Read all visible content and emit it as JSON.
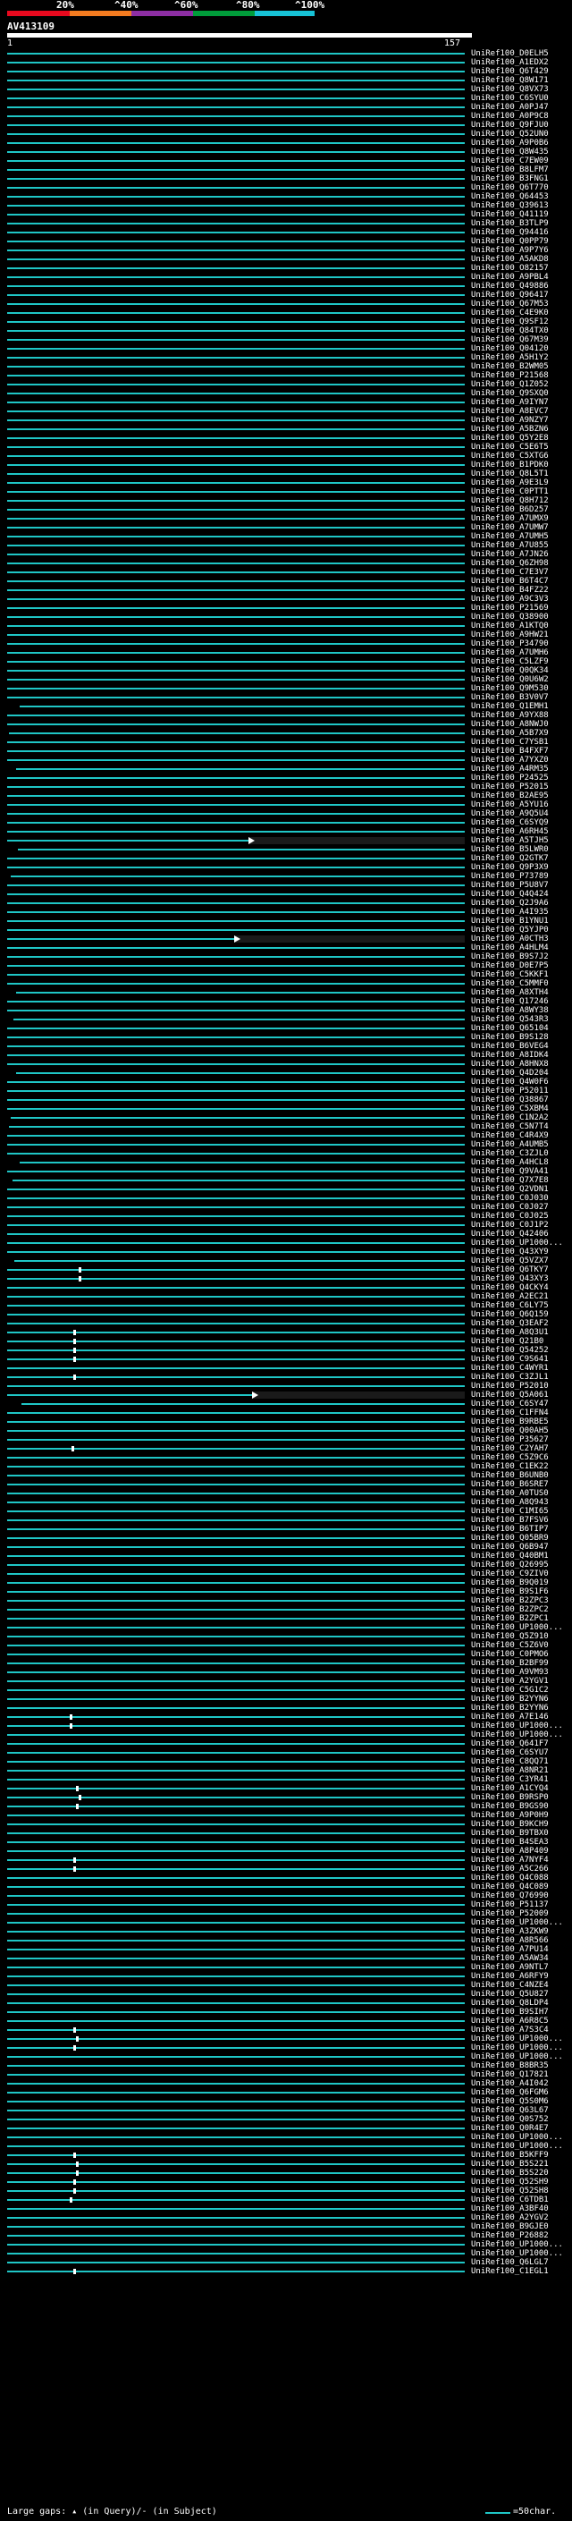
{
  "scale": {
    "labels": [
      "20%",
      "^40%",
      "^60%",
      "^80%",
      "^100%"
    ],
    "colors": [
      "#e8091e",
      "#f47b20",
      "#8d2ea3",
      "#009c3a",
      "#17c2d6"
    ]
  },
  "query": {
    "title": "AV413109",
    "start": "1",
    "end": "157"
  },
  "legend": {
    "gaps": "Large gaps: ▴ (in Query)/- (in Subject)",
    "scale": "=50char."
  },
  "hit_color": "#1fc6c6",
  "hits": [
    "UniRef100_D0ELH5",
    "UniRef100_A1EDX2",
    "UniRef100_Q6T429",
    "UniRef100_Q8W171",
    "UniRef100_Q8VX73",
    "UniRef100_C6SYU0",
    "UniRef100_A0PJ47",
    "UniRef100_A0P9C8",
    "UniRef100_Q9FJU0",
    "UniRef100_Q52UN0",
    "UniRef100_A9P0B6",
    "UniRef100_Q8W435",
    "UniRef100_C7EW09",
    "UniRef100_B8LFM7",
    "UniRef100_B3FNG1",
    "UniRef100_Q6T770",
    "UniRef100_Q64453",
    "UniRef100_Q39613",
    "UniRef100_Q41119",
    "UniRef100_B3TLP9",
    "UniRef100_Q94416",
    "UniRef100_Q0PP79",
    "UniRef100_A9P7Y6",
    "UniRef100_A5AKD8",
    "UniRef100_O82157",
    "UniRef100_A9PBL4",
    "UniRef100_Q49886",
    "UniRef100_Q96417",
    "UniRef100_Q67M53",
    "UniRef100_C4E9K0",
    "UniRef100_Q9SF12",
    "UniRef100_Q84TX0",
    "UniRef100_Q67M39",
    "UniRef100_Q04120",
    "UniRef100_A5H1Y2",
    "UniRef100_B2WM05",
    "UniRef100_P21568",
    "UniRef100_Q1Z052",
    "UniRef100_Q9SXQ0",
    "UniRef100_A9IYN7",
    "UniRef100_A8EVC7",
    "UniRef100_A9NZY7",
    "UniRef100_A5BZN6",
    "UniRef100_Q5Y2E8",
    "UniRef100_C5E6T5",
    "UniRef100_C5XTG6",
    "UniRef100_B1PDK0",
    "UniRef100_Q8L5T1",
    "UniRef100_A9E3L9",
    "UniRef100_C0PTT1",
    "UniRef100_Q8H712",
    "UniRef100_B6D257",
    "UniRef100_A7UMX9",
    "UniRef100_A7UMW7",
    "UniRef100_A7UMH5",
    "UniRef100_A7U855",
    "UniRef100_A7JN26",
    "UniRef100_Q6ZH98",
    "UniRef100_C7E3V7",
    "UniRef100_B6T4C7",
    "UniRef100_B4FZ22",
    "UniRef100_A9C3V3",
    "UniRef100_P21569",
    "UniRef100_Q38900",
    "UniRef100_A1KTQ0",
    "UniRef100_A9HW21",
    "UniRef100_P34790",
    "UniRef100_A7UMH6",
    "UniRef100_C5LZF9",
    "UniRef100_Q0QK34",
    "UniRef100_Q0U6W2",
    "UniRef100_Q9M530",
    "UniRef100_B3V0V7",
    "UniRef100_Q1EMH1",
    "UniRef100_A9YX88",
    "UniRef100_A8NWJ0",
    "UniRef100_A5B7X9",
    "UniRef100_C7YSB1",
    "UniRef100_B4FXF7",
    "UniRef100_A7YXZ0",
    "UniRef100_A4RM35",
    "UniRef100_P24525",
    "UniRef100_P52015",
    "UniRef100_B2AE95",
    "UniRef100_A5YU16",
    "UniRef100_A9Q5U4",
    "UniRef100_C6SYQ9",
    "UniRef100_A6RH45",
    "UniRef100_A5TJH5",
    "UniRef100_B5LWR0",
    "UniRef100_Q2GTK7",
    "UniRef100_Q9P3X9",
    "UniRef100_P73789",
    "UniRef100_P5U8V7",
    "UniRef100_Q4Q424",
    "UniRef100_Q2J9A6",
    "UniRef100_A4I935",
    "UniRef100_B1YNU1",
    "UniRef100_Q5YJP0",
    "UniRef100_A0CTH3",
    "UniRef100_A4HLM4",
    "UniRef100_B9S7J2",
    "UniRef100_D0E7P5",
    "UniRef100_C5KKF1",
    "UniRef100_C5MMF0",
    "UniRef100_A8XTH4",
    "UniRef100_Q17246",
    "UniRef100_A8WY38",
    "UniRef100_Q543R3",
    "UniRef100_Q65104",
    "UniRef100_B9S128",
    "UniRef100_B6VEG4",
    "UniRef100_A8IDK4",
    "UniRef100_A8HNX8",
    "UniRef100_Q4D204",
    "UniRef100_Q4W0F6",
    "UniRef100_P52011",
    "UniRef100_Q38867",
    "UniRef100_C5XBM4",
    "UniRef100_C1N2A2",
    "UniRef100_C5N7T4",
    "UniRef100_C4R4X9",
    "UniRef100_A4UMB5",
    "UniRef100_C3ZJL0",
    "UniRef100_A4HCL8",
    "UniRef100_Q9VA41",
    "UniRef100_Q7X7E8",
    "UniRef100_Q2VDN1",
    "UniRef100_C0J030",
    "UniRef100_C0J027",
    "UniRef100_C0J025",
    "UniRef100_C0J1P2",
    "UniRef100_Q42406",
    "UniRef100_UP1000...",
    "UniRef100_Q43XY9",
    "UniRef100_Q5VZX7",
    "UniRef100_Q6TKY7",
    "UniRef100_Q43XY3",
    "UniRef100_Q4CKY4",
    "UniRef100_A2EC21",
    "UniRef100_C6LY75",
    "UniRef100_Q6Q159",
    "UniRef100_Q3EAF2",
    "UniRef100_A8Q3U1",
    "UniRef100_Q21B0",
    "UniRef100_Q54252",
    "UniRef100_C9S641",
    "UniRef100_C4WYR1",
    "UniRef100_C3ZJL1",
    "UniRef100_P52010",
    "UniRef100_Q5A061",
    "UniRef100_C6SY47",
    "UniRef100_C1FFN4",
    "UniRef100_B9RBE5",
    "UniRef100_Q00AH5",
    "UniRef100_P35627",
    "UniRef100_C2YAH7",
    "UniRef100_C5Z9C6",
    "UniRef100_C1EK22",
    "UniRef100_B6UNB0",
    "UniRef100_B6SRE7",
    "UniRef100_A0TUS0",
    "UniRef100_A8Q943",
    "UniRef100_C1MI65",
    "UniRef100_B7FSV6",
    "UniRef100_B6TIP7",
    "UniRef100_Q05BR9",
    "UniRef100_Q6B947",
    "UniRef100_Q40BM1",
    "UniRef100_Q26995",
    "UniRef100_C9ZIV0",
    "UniRef100_B9Q019",
    "UniRef100_B9S1F6",
    "UniRef100_B2ZPC3",
    "UniRef100_B2ZPC2",
    "UniRef100_B2ZPC1",
    "UniRef100_UP1000...",
    "UniRef100_Q5Z910",
    "UniRef100_C5Z6V0",
    "UniRef100_C0PMO6",
    "UniRef100_B2BF99",
    "UniRef100_A9VM93",
    "UniRef100_A2YGV1",
    "UniRef100_C5G1C2",
    "UniRef100_B2YYN6",
    "UniRef100_B2YYN6",
    "UniRef100_A7E146",
    "UniRef100_UP1000...",
    "UniRef100_UP1000...",
    "UniRef100_Q641F7",
    "UniRef100_C6SYU7",
    "UniRef100_C8QQ71",
    "UniRef100_A8NR21",
    "UniRef100_C3YR41",
    "UniRef100_A1CYQ4",
    "UniRef100_B9RSP0",
    "UniRef100_B9GS90",
    "UniRef100_A9P0H9",
    "UniRef100_B9KCH9",
    "UniRef100_B9TBX0",
    "UniRef100_B4SEA3",
    "UniRef100_A8P409",
    "UniRef100_A7NYF4",
    "UniRef100_A5C266",
    "UniRef100_Q4C088",
    "UniRef100_Q4C089",
    "UniRef100_Q76990",
    "UniRef100_P51137",
    "UniRef100_P52009",
    "UniRef100_UP1000...",
    "UniRef100_A3ZKW9",
    "UniRef100_A8R566",
    "UniRef100_A7PU14",
    "UniRef100_A5AW34",
    "UniRef100_A9NTL7",
    "UniRef100_A6RFY9",
    "UniRef100_C4NZE4",
    "UniRef100_Q5U827",
    "UniRef100_Q8LDP4",
    "UniRef100_B9SIH7",
    "UniRef100_A6R8C5",
    "UniRef100_A7S3C4",
    "UniRef100_UP1000...",
    "UniRef100_UP1000...",
    "UniRef100_UP1000...",
    "UniRef100_B8BR35",
    "UniRef100_Q17821",
    "UniRef100_A4I042",
    "UniRef100_Q6FGM6",
    "UniRef100_Q5S0M6",
    "UniRef100_Q63L67",
    "UniRef100_Q0S752",
    "UniRef100_Q0R4E7",
    "UniRef100_UP1000...",
    "UniRef100_UP1000...",
    "UniRef100_B5KFF9",
    "UniRef100_B5S221",
    "UniRef100_B5S220",
    "UniRef100_Q52SH9",
    "UniRef100_Q52SH8",
    "UniRef100_C6TDB1",
    "UniRef100_A3BF40",
    "UniRef100_A2YGV2",
    "UniRef100_B9GJE0",
    "UniRef100_P26882",
    "UniRef100_UP1000...",
    "UniRef100_UP1000...",
    "UniRef100_Q6LGL7",
    "UniRef100_C1EGL1"
  ]
}
